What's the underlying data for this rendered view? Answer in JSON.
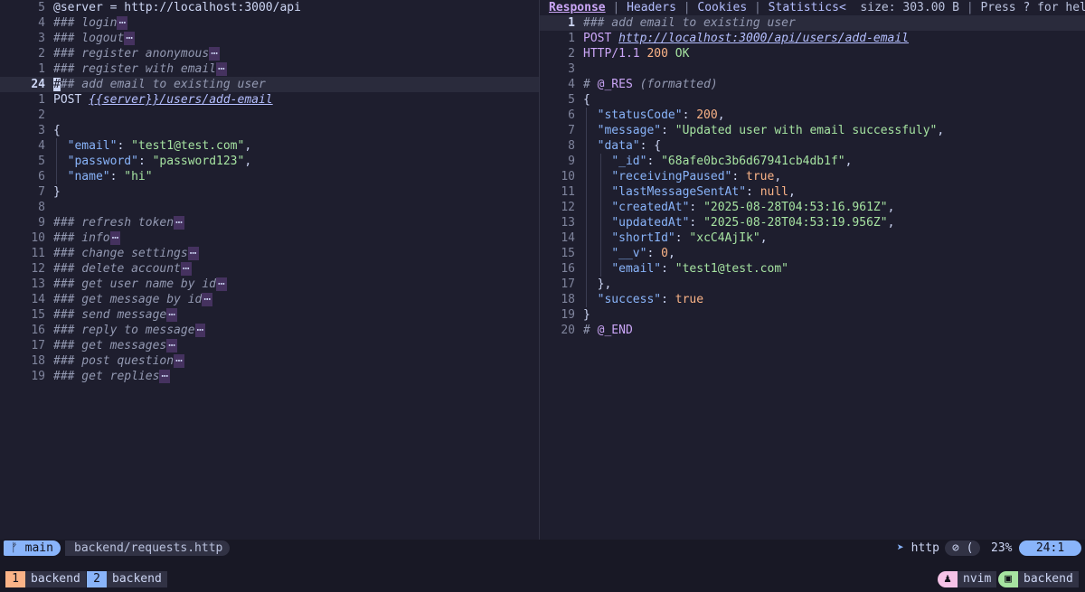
{
  "left_pane": {
    "lines": [
      {
        "ln": "5",
        "segs": [
          [
            "c-text",
            "@server = http://localhost:3000/api"
          ]
        ]
      },
      {
        "ln": "4",
        "segs": [
          [
            "c-cmt",
            "### login"
          ],
          [
            "fold",
            "⋯"
          ]
        ]
      },
      {
        "ln": "3",
        "segs": [
          [
            "c-cmt",
            "### logout"
          ],
          [
            "fold",
            "⋯"
          ]
        ]
      },
      {
        "ln": "2",
        "segs": [
          [
            "c-cmt",
            "### register anonymous"
          ],
          [
            "fold",
            "⋯"
          ]
        ]
      },
      {
        "ln": "1",
        "segs": [
          [
            "c-cmt",
            "### register with email"
          ],
          [
            "fold",
            "⋯"
          ]
        ]
      },
      {
        "ln": "24",
        "current": true,
        "segs": [
          [
            "cursor",
            "#"
          ],
          [
            "c-cmt",
            "## add email to existing user"
          ]
        ]
      },
      {
        "ln": "1",
        "segs": [
          [
            "c-text",
            "POST "
          ],
          [
            "c-url",
            "{{server}}/users/add-email"
          ]
        ]
      },
      {
        "ln": "2",
        "segs": []
      },
      {
        "ln": "3",
        "segs": [
          [
            "c-text",
            "{"
          ]
        ]
      },
      {
        "ln": "4",
        "guide": 1,
        "segs": [
          [
            "c-text",
            "  "
          ],
          [
            "c-key",
            "\"email\""
          ],
          [
            "c-text",
            ": "
          ],
          [
            "c-str",
            "\"test1@test.com\""
          ],
          [
            "c-text",
            ","
          ]
        ]
      },
      {
        "ln": "5",
        "guide": 1,
        "segs": [
          [
            "c-text",
            "  "
          ],
          [
            "c-key",
            "\"password\""
          ],
          [
            "c-text",
            ": "
          ],
          [
            "c-str",
            "\"password123\""
          ],
          [
            "c-text",
            ","
          ]
        ]
      },
      {
        "ln": "6",
        "guide": 1,
        "segs": [
          [
            "c-text",
            "  "
          ],
          [
            "c-key",
            "\"name\""
          ],
          [
            "c-text",
            ": "
          ],
          [
            "c-str",
            "\"hi\""
          ]
        ]
      },
      {
        "ln": "7",
        "segs": [
          [
            "c-text",
            "}"
          ]
        ]
      },
      {
        "ln": "8",
        "segs": []
      },
      {
        "ln": "9",
        "segs": [
          [
            "c-cmt",
            "### refresh token"
          ],
          [
            "fold",
            "⋯"
          ]
        ]
      },
      {
        "ln": "10",
        "segs": [
          [
            "c-cmt",
            "### info"
          ],
          [
            "fold",
            "⋯"
          ]
        ]
      },
      {
        "ln": "11",
        "segs": [
          [
            "c-cmt",
            "### change settings"
          ],
          [
            "fold",
            "⋯"
          ]
        ]
      },
      {
        "ln": "12",
        "segs": [
          [
            "c-cmt",
            "### delete account"
          ],
          [
            "fold",
            "⋯"
          ]
        ]
      },
      {
        "ln": "13",
        "segs": [
          [
            "c-cmt",
            "### get user name by id"
          ],
          [
            "fold",
            "⋯"
          ]
        ]
      },
      {
        "ln": "14",
        "segs": [
          [
            "c-cmt",
            "### get message by id"
          ],
          [
            "fold",
            "⋯"
          ]
        ]
      },
      {
        "ln": "15",
        "segs": [
          [
            "c-cmt",
            "### send message"
          ],
          [
            "fold",
            "⋯"
          ]
        ]
      },
      {
        "ln": "16",
        "segs": [
          [
            "c-cmt",
            "### reply to message"
          ],
          [
            "fold",
            "⋯"
          ]
        ]
      },
      {
        "ln": "17",
        "segs": [
          [
            "c-cmt",
            "### get messages"
          ],
          [
            "fold",
            "⋯"
          ]
        ]
      },
      {
        "ln": "18",
        "segs": [
          [
            "c-cmt",
            "### post question"
          ],
          [
            "fold",
            "⋯"
          ]
        ]
      },
      {
        "ln": "19",
        "segs": [
          [
            "c-cmt",
            "### get replies"
          ],
          [
            "fold",
            "⋯"
          ]
        ]
      }
    ]
  },
  "right_pane": {
    "tabs": {
      "response": "Response",
      "headers": "Headers",
      "cookies": "Cookies",
      "statistics": "Statistics<",
      "size": "size: 303.00 B",
      "help": "Press ? for help"
    },
    "lines": [
      {
        "ln": "1",
        "current": true,
        "segs": [
          [
            "c-cmt",
            "### add email to existing user"
          ]
        ]
      },
      {
        "ln": "1",
        "segs": [
          [
            "c-mauve",
            "POST "
          ],
          [
            "c-url",
            "http://localhost:3000/api/users/add-email"
          ]
        ]
      },
      {
        "ln": "2",
        "segs": [
          [
            "c-mauve",
            "HTTP/1.1 "
          ],
          [
            "c-num",
            "200 "
          ],
          [
            "c-str",
            "OK"
          ]
        ]
      },
      {
        "ln": "3",
        "segs": []
      },
      {
        "ln": "4",
        "segs": [
          [
            "c-cmt",
            "# "
          ],
          [
            "c-mauve",
            "@_RES"
          ],
          [
            "c-cmt",
            " (formatted)"
          ]
        ]
      },
      {
        "ln": "5",
        "segs": [
          [
            "c-text",
            "{"
          ]
        ]
      },
      {
        "ln": "6",
        "guide": 1,
        "segs": [
          [
            "c-text",
            "  "
          ],
          [
            "c-key",
            "\"statusCode\""
          ],
          [
            "c-text",
            ": "
          ],
          [
            "c-num",
            "200"
          ],
          [
            "c-text",
            ","
          ]
        ]
      },
      {
        "ln": "7",
        "guide": 1,
        "segs": [
          [
            "c-text",
            "  "
          ],
          [
            "c-key",
            "\"message\""
          ],
          [
            "c-text",
            ": "
          ],
          [
            "c-str",
            "\"Updated user with email successfuly\""
          ],
          [
            "c-text",
            ","
          ]
        ]
      },
      {
        "ln": "8",
        "guide": 1,
        "segs": [
          [
            "c-text",
            "  "
          ],
          [
            "c-key",
            "\"data\""
          ],
          [
            "c-text",
            ": {"
          ]
        ]
      },
      {
        "ln": "9",
        "guide": 2,
        "segs": [
          [
            "c-text",
            "    "
          ],
          [
            "c-key",
            "\"_id\""
          ],
          [
            "c-text",
            ": "
          ],
          [
            "c-str",
            "\"68afe0bc3b6d67941cb4db1f\""
          ],
          [
            "c-text",
            ","
          ]
        ]
      },
      {
        "ln": "10",
        "guide": 2,
        "segs": [
          [
            "c-text",
            "    "
          ],
          [
            "c-key",
            "\"receivingPaused\""
          ],
          [
            "c-text",
            ": "
          ],
          [
            "c-num",
            "true"
          ],
          [
            "c-text",
            ","
          ]
        ]
      },
      {
        "ln": "11",
        "guide": 2,
        "segs": [
          [
            "c-text",
            "    "
          ],
          [
            "c-key",
            "\"lastMessageSentAt\""
          ],
          [
            "c-text",
            ": "
          ],
          [
            "c-num",
            "null"
          ],
          [
            "c-text",
            ","
          ]
        ]
      },
      {
        "ln": "12",
        "guide": 2,
        "segs": [
          [
            "c-text",
            "    "
          ],
          [
            "c-key",
            "\"createdAt\""
          ],
          [
            "c-text",
            ": "
          ],
          [
            "c-str",
            "\"2025-08-28T04:53:16.961Z\""
          ],
          [
            "c-text",
            ","
          ]
        ]
      },
      {
        "ln": "13",
        "guide": 2,
        "segs": [
          [
            "c-text",
            "    "
          ],
          [
            "c-key",
            "\"updatedAt\""
          ],
          [
            "c-text",
            ": "
          ],
          [
            "c-str",
            "\"2025-08-28T04:53:19.956Z\""
          ],
          [
            "c-text",
            ","
          ]
        ]
      },
      {
        "ln": "14",
        "guide": 2,
        "segs": [
          [
            "c-text",
            "    "
          ],
          [
            "c-key",
            "\"shortId\""
          ],
          [
            "c-text",
            ": "
          ],
          [
            "c-str",
            "\"xcC4AjIk\""
          ],
          [
            "c-text",
            ","
          ]
        ]
      },
      {
        "ln": "15",
        "guide": 2,
        "segs": [
          [
            "c-text",
            "    "
          ],
          [
            "c-key",
            "\"__v\""
          ],
          [
            "c-text",
            ": "
          ],
          [
            "c-num",
            "0"
          ],
          [
            "c-text",
            ","
          ]
        ]
      },
      {
        "ln": "16",
        "guide": 2,
        "segs": [
          [
            "c-text",
            "    "
          ],
          [
            "c-key",
            "\"email\""
          ],
          [
            "c-text",
            ": "
          ],
          [
            "c-str",
            "\"test1@test.com\""
          ]
        ]
      },
      {
        "ln": "17",
        "guide": 1,
        "segs": [
          [
            "c-text",
            "  },"
          ]
        ]
      },
      {
        "ln": "18",
        "guide": 1,
        "segs": [
          [
            "c-text",
            "  "
          ],
          [
            "c-key",
            "\"success\""
          ],
          [
            "c-text",
            ": "
          ],
          [
            "c-num",
            "true"
          ]
        ]
      },
      {
        "ln": "19",
        "segs": [
          [
            "c-text",
            "}"
          ]
        ]
      },
      {
        "ln": "20",
        "segs": [
          [
            "c-cmt",
            "# "
          ],
          [
            "c-mauve",
            "@_END"
          ]
        ]
      }
    ]
  },
  "statusline": {
    "branch": "main",
    "filepath": "backend/requests.http",
    "filetype": "http",
    "percent": "23%",
    "position": "24:1"
  },
  "tmux": {
    "windows": [
      {
        "num": "1",
        "name": "backend"
      },
      {
        "num": "2",
        "name": "backend"
      }
    ],
    "process": "nvim",
    "session": "backend"
  },
  "icons": {
    "branch": "git-branch-icon",
    "send": "send-icon",
    "diagnostics": "no-diagnostics-icon",
    "nvim": "nvim-icon",
    "terminal": "terminal-icon"
  },
  "colors": {
    "background": "#1e1e2e",
    "accent_blue": "#89b4fa",
    "accent_mauve": "#cba6f7",
    "accent_green": "#a6e3a1",
    "accent_peach": "#fab387"
  }
}
